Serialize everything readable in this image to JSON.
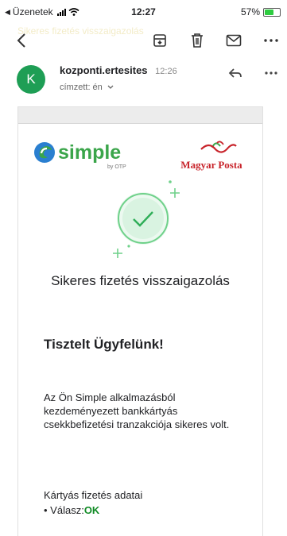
{
  "status_bar": {
    "back_app": "Üzenetek",
    "time": "12:27",
    "battery": "57%"
  },
  "toolbar": {
    "icons": [
      "back-arrow-icon",
      "archive-icon",
      "delete-icon",
      "mark-unread-icon",
      "more-options-icon"
    ],
    "ghost_subject": "Sikeres fizetés visszaigazolás"
  },
  "sender": {
    "avatar_letter": "K",
    "name": "kozponti.ertesites",
    "time": "12:26",
    "recipient_label": "címzett: én"
  },
  "email": {
    "logo_left": {
      "name": "simple",
      "tagline": "by OTP"
    },
    "logo_right": {
      "name": "Magyar Posta"
    },
    "title": "Sikeres fizetés visszaigazolás",
    "greeting": "Tisztelt Ügyfelünk!",
    "message": "Az Ön Simple alkalmazásból kezdeményezett bankkártyás csekkbefizetési tranzakciója sikeres volt.",
    "details_title": "Kártyás fizetés adatai",
    "details": [
      {
        "label": "Válasz:",
        "value": "OK"
      }
    ]
  },
  "colors": {
    "avatar": "#1e9e55",
    "success_green": "#6fd18a",
    "ok_green": "#0f8a24",
    "simple_blue": "#2a7fd0",
    "simple_green": "#3aa54a",
    "posta_red": "#c8242b"
  }
}
